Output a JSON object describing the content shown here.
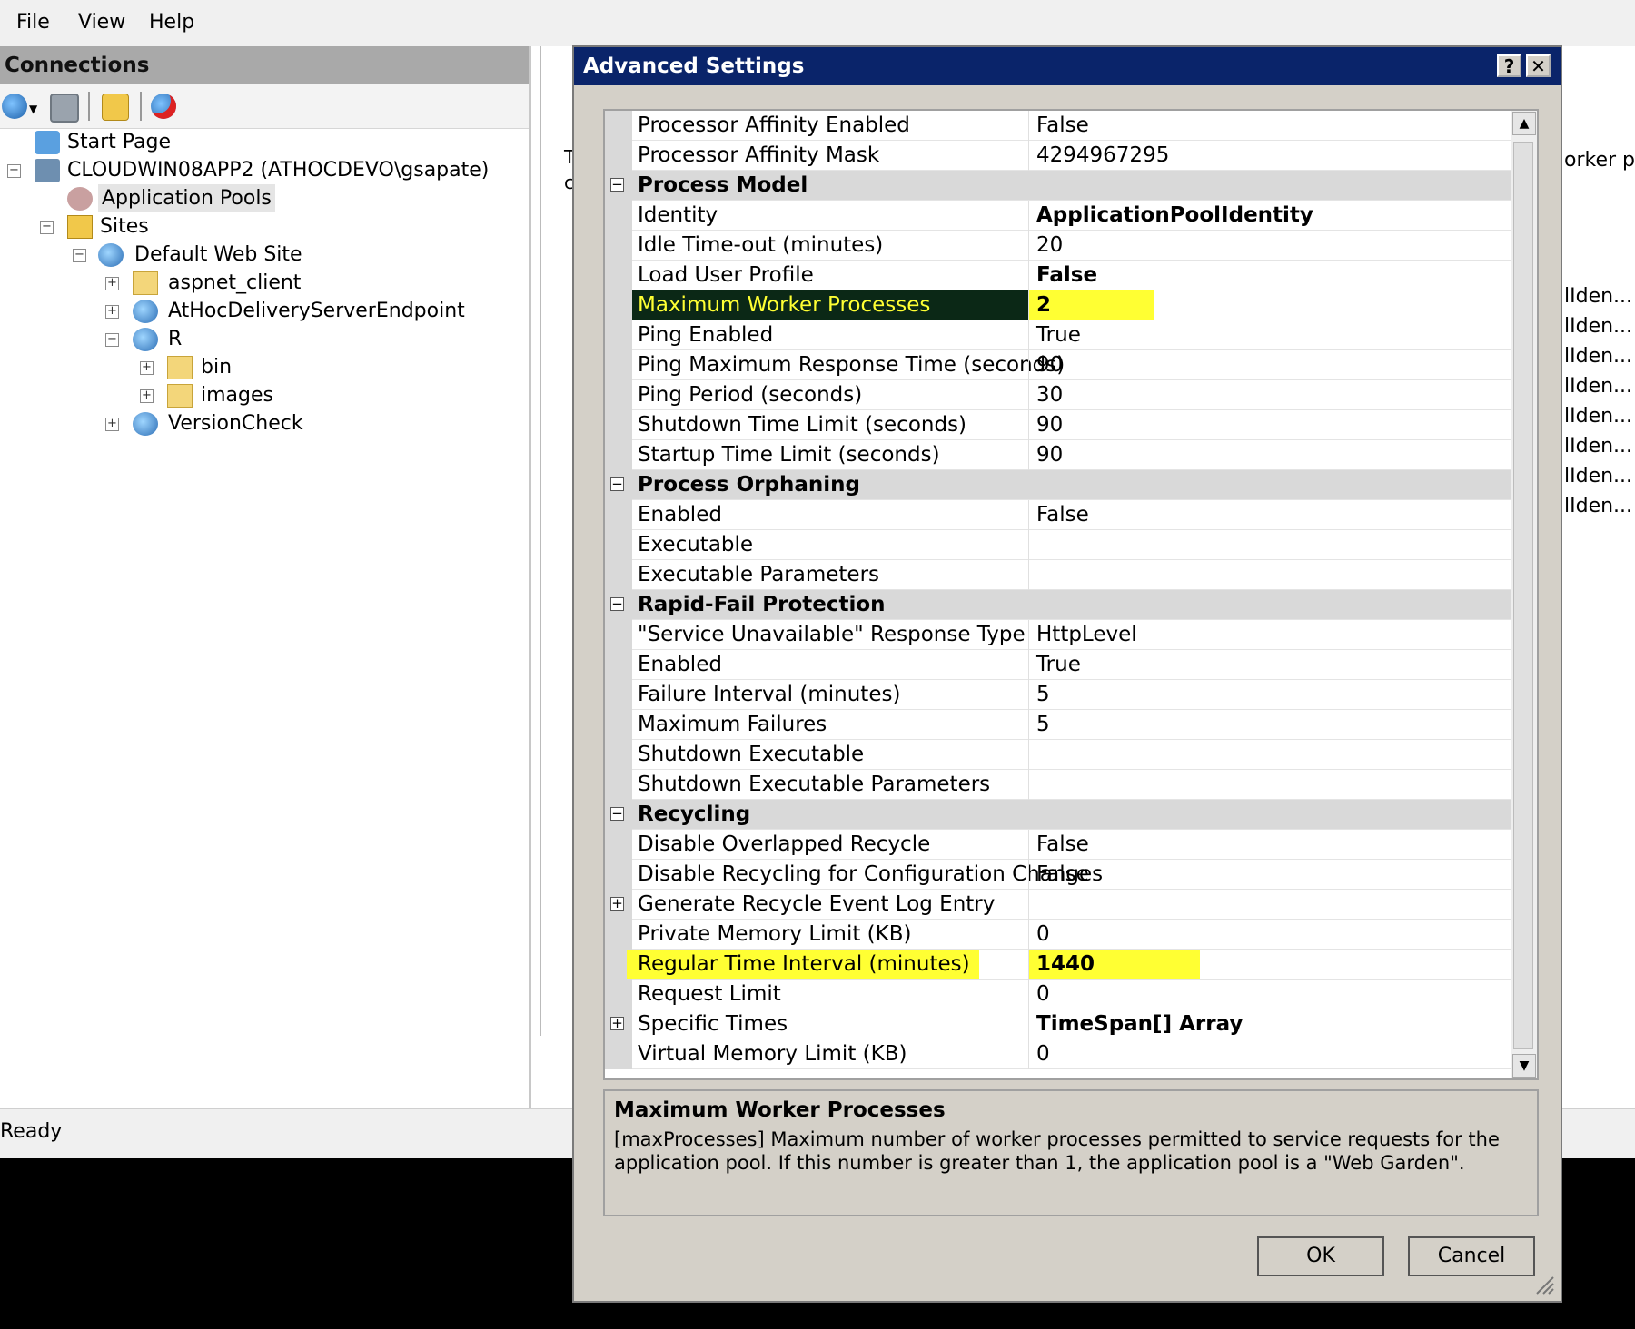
{
  "menu": {
    "file": "File",
    "view": "View",
    "help": "Help"
  },
  "connections": {
    "header": "Connections"
  },
  "tree": {
    "start_page": "Start Page",
    "server": "CLOUDWIN08APP2 (ATHOCDEVO\\gsapate)",
    "app_pools": "Application Pools",
    "sites": "Sites",
    "default_site": "Default Web Site",
    "aspnet_client": "aspnet_client",
    "athoc_endpoint": "AtHocDeliveryServerEndpoint",
    "r": "R",
    "bin": "bin",
    "images": "images",
    "version_check": "VersionCheck"
  },
  "right_pane": {
    "edge_top": "orker pro",
    "edge_list": [
      "lIden...",
      "lIden...",
      "lIden...",
      "lIden...",
      "lIden...",
      "lIden...",
      "lIden...",
      "lIden..."
    ],
    "left_clip": [
      "T",
      "c"
    ]
  },
  "status": {
    "text": "Ready"
  },
  "dialog": {
    "title": "Advanced Settings",
    "help_btn": "?",
    "close_btn": "✕",
    "rows": [
      {
        "n": "Processor Affinity Enabled",
        "v": "False"
      },
      {
        "n": "Processor Affinity Mask",
        "v": "4294967295"
      },
      {
        "n": "Process Model",
        "v": ""
      },
      {
        "n": "Identity",
        "v": "ApplicationPoolIdentity"
      },
      {
        "n": "Idle Time-out (minutes)",
        "v": "20"
      },
      {
        "n": "Load User Profile",
        "v": "False"
      },
      {
        "n": "Maximum Worker Processes",
        "v": "2"
      },
      {
        "n": "Ping Enabled",
        "v": "True"
      },
      {
        "n": "Ping Maximum Response Time (seconds)",
        "v": "90"
      },
      {
        "n": "Ping Period (seconds)",
        "v": "30"
      },
      {
        "n": "Shutdown Time Limit (seconds)",
        "v": "90"
      },
      {
        "n": "Startup Time Limit (seconds)",
        "v": "90"
      },
      {
        "n": "Process Orphaning",
        "v": ""
      },
      {
        "n": "Enabled",
        "v": "False"
      },
      {
        "n": "Executable",
        "v": ""
      },
      {
        "n": "Executable Parameters",
        "v": ""
      },
      {
        "n": "Rapid-Fail Protection",
        "v": ""
      },
      {
        "n": "\"Service Unavailable\" Response Type",
        "v": "HttpLevel"
      },
      {
        "n": "Enabled",
        "v": "True"
      },
      {
        "n": "Failure Interval (minutes)",
        "v": "5"
      },
      {
        "n": "Maximum Failures",
        "v": "5"
      },
      {
        "n": "Shutdown Executable",
        "v": ""
      },
      {
        "n": "Shutdown Executable Parameters",
        "v": ""
      },
      {
        "n": "Recycling",
        "v": ""
      },
      {
        "n": "Disable Overlapped Recycle",
        "v": "False"
      },
      {
        "n": "Disable Recycling for Configuration Changes",
        "v": "False"
      },
      {
        "n": "Generate Recycle Event Log Entry",
        "v": ""
      },
      {
        "n": "Private Memory Limit (KB)",
        "v": "0"
      },
      {
        "n": "Regular Time Interval (minutes)",
        "v": "1440"
      },
      {
        "n": "Request Limit",
        "v": "0"
      },
      {
        "n": "Specific Times",
        "v": "TimeSpan[] Array"
      },
      {
        "n": "Virtual Memory Limit (KB)",
        "v": "0"
      }
    ],
    "category_glyph": "⊟",
    "expand_glyph": "⊞",
    "description": {
      "title": "Maximum Worker Processes",
      "body": "[maxProcesses] Maximum number of worker processes permitted to service requests for the application pool. If this number is greater than 1, the application pool is a \"Web Garden\"."
    },
    "ok": "OK",
    "cancel": "Cancel"
  },
  "icons": [
    "globe-connect-icon",
    "save-icon",
    "folder-up-icon",
    "disconnect-icon",
    "start-page-icon",
    "server-icon",
    "app-pool-icon",
    "sites-folder-icon",
    "globe-site-icon",
    "folder-icon",
    "chevron-down-icon",
    "scroll-up-icon",
    "scroll-down-icon",
    "resize-grip-icon"
  ],
  "colors": {
    "title_bar": "#0a246a",
    "highlight": "#ffff33",
    "selected_row": "#0b2816",
    "category_bg": "#d9d9d9"
  }
}
